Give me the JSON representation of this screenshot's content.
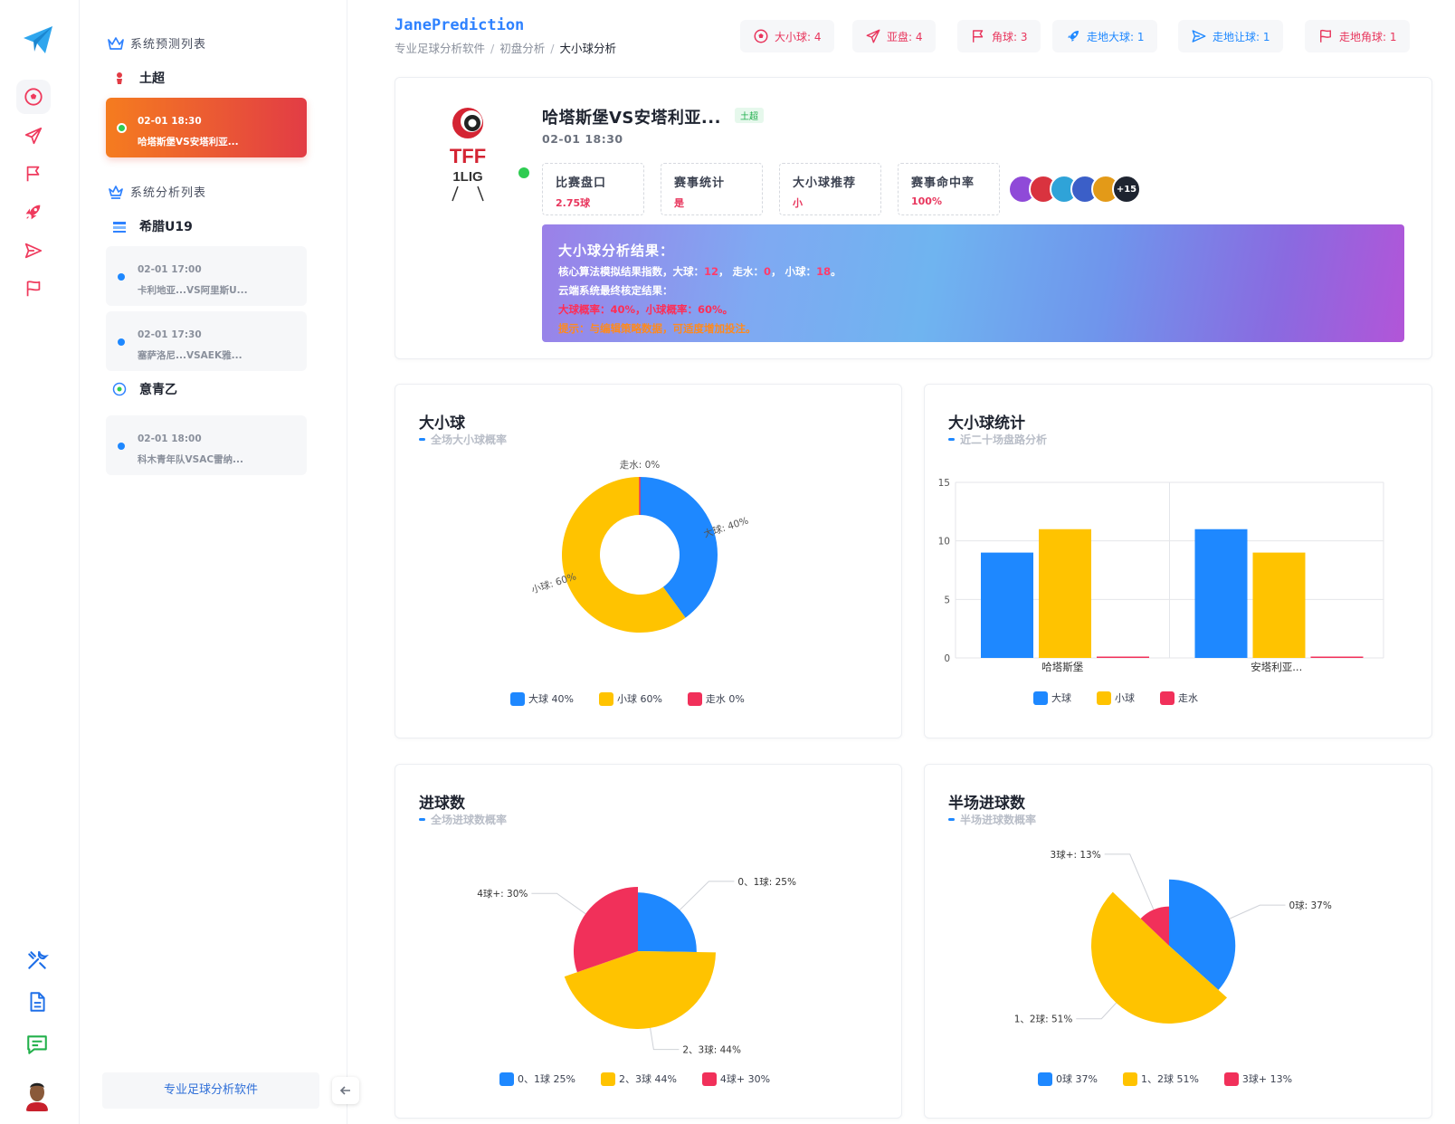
{
  "app": {
    "brand": "JanePrediction",
    "breadcrumbs": [
      "专业足球分析软件",
      "初盘分析",
      "大小球分析"
    ]
  },
  "colors": {
    "big": "#1e88ff",
    "small": "#ffc300",
    "push": "#f1305a",
    "accent_red": "#e8365d",
    "accent_blue": "#1e88ff"
  },
  "rail": {
    "logo_icon": "paper-plane-logo-icon",
    "nav": [
      "soccer-ball-icon",
      "send-icon",
      "flag-icon",
      "rocket-icon",
      "send-fast-icon",
      "flag-outline-icon"
    ],
    "bottom": [
      "tools-icon",
      "document-icon",
      "message-icon"
    ]
  },
  "sidebar": {
    "predict_title": "系统预测列表",
    "predict_leagues": [
      {
        "name": "土超",
        "matches": [
          {
            "time": "02-01 18:30",
            "name": "哈塔斯堡VS安塔利亚...",
            "active": true
          }
        ]
      }
    ],
    "analysis_title": "系统分析列表",
    "analysis_leagues": [
      {
        "name": "希腊U19",
        "matches": [
          {
            "time": "02-01 17:00",
            "name": "卡利地亚...VS阿里斯U..."
          },
          {
            "time": "02-01 17:30",
            "name": "塞萨洛尼...VSAEK雅..."
          }
        ]
      },
      {
        "name": "意青乙",
        "matches": [
          {
            "time": "02-01 18:00",
            "name": "科木青年队VSAC雷纳..."
          }
        ]
      }
    ],
    "footer": "专业足球分析软件"
  },
  "chips": [
    {
      "icon": "soccer-ball-icon",
      "label": "大小球: 4",
      "tone": "red"
    },
    {
      "icon": "send-icon",
      "label": "亚盘: 4",
      "tone": "red"
    },
    {
      "icon": "flag-icon",
      "label": "角球: 3",
      "tone": "red"
    },
    {
      "icon": "rocket-icon",
      "label": "走地大球: 1",
      "tone": "blue"
    },
    {
      "icon": "send-fast-icon",
      "label": "走地让球: 1",
      "tone": "blue"
    },
    {
      "icon": "flag-outline-icon",
      "label": "走地角球: 1",
      "tone": "red"
    }
  ],
  "match": {
    "title": "哈塔斯堡VS安塔利亚...",
    "league_tag": "土超",
    "time": "02-01 18:30",
    "logo_text": "TFF",
    "logo_sub": "1LIG",
    "stats": [
      {
        "label": "比赛盘口",
        "value": "2.75球"
      },
      {
        "label": "赛事统计",
        "value": "是"
      },
      {
        "label": "大小球推荐",
        "value": "小"
      },
      {
        "label": "赛事命中率",
        "value": "100%"
      }
    ],
    "more_avatars": "+15",
    "result": {
      "heading": "大小球分析结果：",
      "line1_prefix": "核心算法模拟结果指数，",
      "big_label": "大球：",
      "big_value": "12",
      "push_label": "，  走水：",
      "push_value": "0",
      "small_label": "，  小球：",
      "small_value": "18",
      "line1_end": "。",
      "line2": "云端系统最终核定结果：",
      "line3": "大球概率：40%，小球概率：60%。",
      "line4": "提示：与编辑策略数据，可适度增加投注。"
    }
  },
  "charts": {
    "ou": {
      "title": "大小球",
      "subtitle": "全场大小球概率"
    },
    "ou_stats": {
      "title": "大小球统计",
      "subtitle": "近二十场盘路分析"
    },
    "goals": {
      "title": "进球数",
      "subtitle": "全场进球数概率"
    },
    "half_goals": {
      "title": "半场进球数",
      "subtitle": "半场进球数概率"
    }
  },
  "chart_data": [
    {
      "type": "pie",
      "title": "大小球",
      "subtitle": "全场大小球概率",
      "slices": [
        {
          "label": "大球",
          "value": 40
        },
        {
          "label": "小球",
          "value": 60
        },
        {
          "label": "走水",
          "value": 0
        }
      ],
      "slice_labels": [
        "大球: 40%",
        "小球: 60%",
        "走水: 0%"
      ],
      "legend": [
        "大球 40%",
        "小球 60%",
        "走水 0%"
      ]
    },
    {
      "type": "bar",
      "title": "大小球统计",
      "subtitle": "近二十场盘路分析",
      "categories": [
        "哈塔斯堡",
        "安塔利亚..."
      ],
      "series": [
        {
          "name": "大球",
          "values": [
            9,
            11
          ]
        },
        {
          "name": "小球",
          "values": [
            11,
            9
          ]
        },
        {
          "name": "走水",
          "values": [
            0,
            0
          ]
        }
      ],
      "ylim": [
        0,
        15
      ],
      "yticks": [
        "0",
        "5",
        "10",
        "15"
      ],
      "grid": true,
      "legend": "bottom"
    },
    {
      "type": "pie",
      "title": "进球数",
      "subtitle": "全场进球数概率",
      "slices": [
        {
          "label": "0、1球",
          "value": 25
        },
        {
          "label": "2、3球",
          "value": 44
        },
        {
          "label": "4球+",
          "value": 30
        }
      ],
      "slice_labels": [
        "0、1球: 25%",
        "2、3球: 44%",
        "4球+: 30%"
      ],
      "legend": [
        "0、1球 25%",
        "2、3球 44%",
        "4球+ 30%"
      ]
    },
    {
      "type": "pie",
      "title": "半场进球数",
      "subtitle": "半场进球数概率",
      "slices": [
        {
          "label": "0球",
          "value": 37
        },
        {
          "label": "1、2球",
          "value": 51
        },
        {
          "label": "3球+",
          "value": 13
        }
      ],
      "slice_labels": [
        "0球: 37%",
        "1、2球: 51%",
        "3球+: 13%"
      ],
      "legend": [
        "0球 37%",
        "1、2球 51%",
        "3球+ 13%"
      ]
    }
  ]
}
